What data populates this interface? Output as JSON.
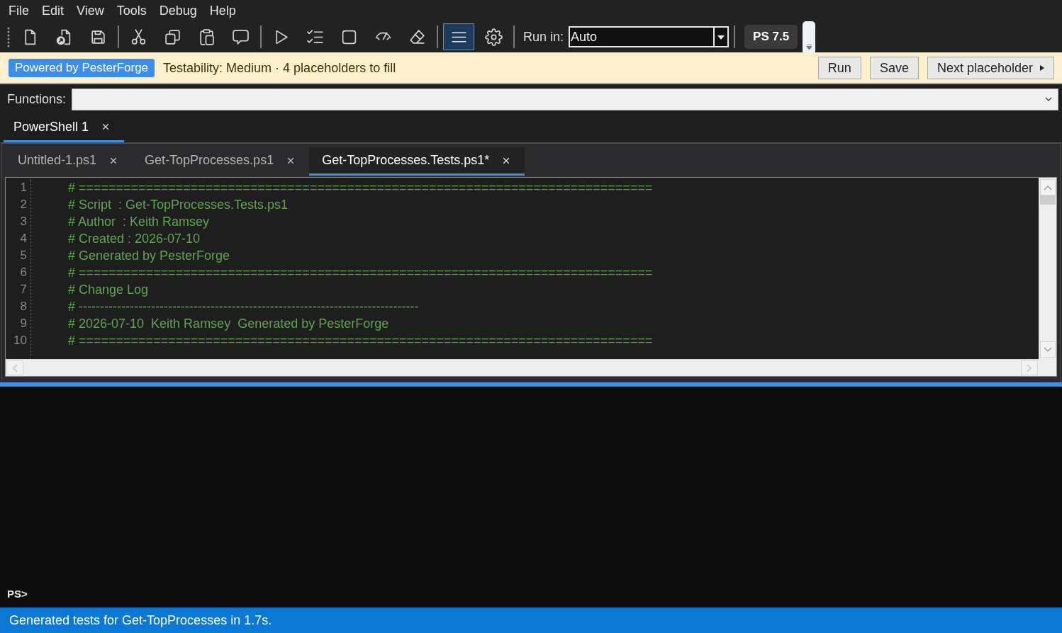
{
  "menu": [
    "File",
    "Edit",
    "View",
    "Tools",
    "Debug",
    "Help"
  ],
  "toolbar": {
    "groups": [
      [
        {
          "kind": "new",
          "selected": false
        },
        {
          "kind": "open",
          "selected": false
        },
        {
          "kind": "save",
          "selected": false
        }
      ],
      [
        {
          "kind": "cut",
          "selected": false
        },
        {
          "kind": "copy",
          "selected": false
        },
        {
          "kind": "paste",
          "selected": false
        },
        {
          "kind": "comment",
          "selected": false
        }
      ],
      [
        {
          "kind": "run",
          "selected": false
        },
        {
          "kind": "selection",
          "selected": false
        },
        {
          "kind": "stop",
          "selected": false
        },
        {
          "kind": "debug",
          "selected": false
        },
        {
          "kind": "clear",
          "selected": false
        }
      ],
      [
        {
          "kind": "toggle",
          "selected": true
        },
        {
          "kind": "settings",
          "selected": false
        }
      ]
    ],
    "run_in": {
      "label": "Run in:",
      "value": "Auto"
    },
    "version_badge": "PS 7.5"
  },
  "banner": {
    "badge": "Powered by PesterForge",
    "message": "Testability: Medium · 4 placeholders to fill",
    "buttons": [
      {
        "label": "Run",
        "kind": "plain"
      },
      {
        "label": "Save",
        "kind": "plain"
      },
      {
        "label": "Next placeholder",
        "kind": "dropdown"
      }
    ]
  },
  "functions": {
    "label": "Functions:"
  },
  "session_tabs": [
    {
      "label": "PowerShell 1",
      "selected": true
    }
  ],
  "file_tabs": [
    {
      "label": "Untitled-1.ps1",
      "selected": false
    },
    {
      "label": "Get-TopProcesses.ps1",
      "selected": false
    },
    {
      "label": "Get-TopProcesses.Tests.ps1*",
      "selected": true
    }
  ],
  "editor": {
    "lines": [
      {
        "number": "1",
        "text": "# ============================================================================="
      },
      {
        "number": "2",
        "text": "# Script  : Get-TopProcesses.Tests.ps1"
      },
      {
        "number": "3",
        "text": "# Author  : Keith Ramsey"
      },
      {
        "number": "4",
        "text": "# Created : 2026-07-10"
      },
      {
        "number": "5",
        "text": "# Generated by PesterForge"
      },
      {
        "number": "6",
        "text": "# ============================================================================="
      },
      {
        "number": "7",
        "text": "# Change Log"
      },
      {
        "number": "8",
        "text": "# --------------------------------------------------------------------------------"
      },
      {
        "number": "9",
        "text": "# 2026-07-10  Keith Ramsey  Generated by PesterForge"
      },
      {
        "number": "10",
        "text": "# ============================================================================="
      }
    ]
  },
  "console": {
    "prompt": "PS>"
  },
  "status_bar": {
    "text": "Generated tests for Get-TopProcesses in 1.7s."
  }
}
